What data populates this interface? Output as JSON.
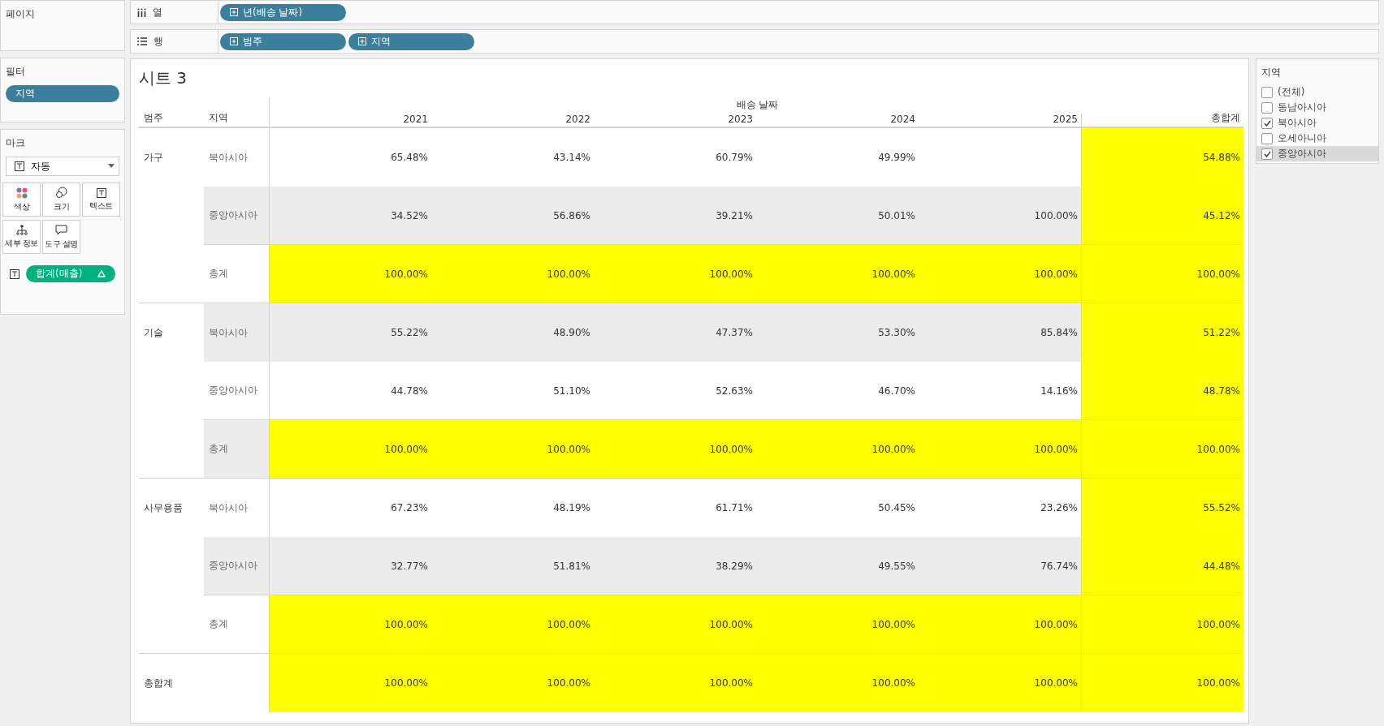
{
  "pages_panel": {
    "title": "페이지"
  },
  "shelves": [
    {
      "kind": "columns",
      "label": "열",
      "pills": [
        "년(배송 날짜)"
      ]
    },
    {
      "kind": "rows",
      "label": "행",
      "pills": [
        "범주",
        "지역"
      ]
    }
  ],
  "filters_panel": {
    "title": "필터",
    "pills": [
      "지역"
    ]
  },
  "marks_panel": {
    "title": "마크",
    "mark_type": "자동",
    "cards": [
      {
        "kind": "color",
        "label": "색상"
      },
      {
        "kind": "size",
        "label": "크기"
      },
      {
        "kind": "text",
        "label": "텍스트"
      },
      {
        "kind": "detail",
        "label": "세부 정보"
      },
      {
        "kind": "tooltip",
        "label": "도구 설명"
      }
    ],
    "fields": [
      {
        "kind": "text",
        "label": "합계(매출)",
        "table_calc": true
      }
    ]
  },
  "sheet": {
    "title": "시트 3",
    "column_header": "배송 날짜",
    "row_headers": [
      "범주",
      "지역"
    ],
    "columns": [
      {
        "label": "2021",
        "highlighted": false
      },
      {
        "label": "2022",
        "highlighted": false
      },
      {
        "label": "2023",
        "highlighted": false
      },
      {
        "label": "2024",
        "highlighted": false
      },
      {
        "label": "2025",
        "highlighted": false
      },
      {
        "label": "총합계",
        "highlighted": true
      }
    ],
    "groups": [
      {
        "category": "가구",
        "rows": [
          {
            "region": "북아시아",
            "banded": false,
            "highlighted": false,
            "cells": [
              {
                "kind": "value",
                "text": "65.48%"
              },
              {
                "kind": "value",
                "text": "43.14%"
              },
              {
                "kind": "value",
                "text": "60.79%"
              },
              {
                "kind": "value",
                "text": "49.99%"
              },
              {
                "kind": "empty"
              },
              {
                "kind": "value",
                "text": "54.88%"
              }
            ]
          },
          {
            "region": "중앙아시아",
            "banded": true,
            "highlighted": false,
            "values": [
              "34.52%",
              "56.86%",
              "39.21%",
              "50.01%",
              "100.00%",
              "45.12%"
            ]
          },
          {
            "region": "총계",
            "banded": false,
            "highlighted": true,
            "values": [
              "100.00%",
              "100.00%",
              "100.00%",
              "100.00%",
              "100.00%",
              "100.00%"
            ]
          }
        ]
      },
      {
        "category": "기술",
        "rows": [
          {
            "region": "북아시아",
            "banded": true,
            "highlighted": false,
            "values": [
              "55.22%",
              "48.90%",
              "47.37%",
              "53.30%",
              "85.84%",
              "51.22%"
            ]
          },
          {
            "region": "중앙아시아",
            "banded": false,
            "highlighted": false,
            "values": [
              "44.78%",
              "51.10%",
              "52.63%",
              "46.70%",
              "14.16%",
              "48.78%"
            ]
          },
          {
            "region": "총계",
            "banded": true,
            "highlighted": true,
            "values": [
              "100.00%",
              "100.00%",
              "100.00%",
              "100.00%",
              "100.00%",
              "100.00%"
            ]
          }
        ]
      },
      {
        "category": "사무용품",
        "rows": [
          {
            "region": "북아시아",
            "banded": false,
            "highlighted": false,
            "values": [
              "67.23%",
              "48.19%",
              "61.71%",
              "50.45%",
              "23.26%",
              "55.52%"
            ]
          },
          {
            "region": "중앙아시아",
            "banded": true,
            "highlighted": false,
            "values": [
              "32.77%",
              "51.81%",
              "38.29%",
              "49.55%",
              "76.74%",
              "44.48%"
            ]
          },
          {
            "region": "총계",
            "banded": false,
            "highlighted": true,
            "values": [
              "100.00%",
              "100.00%",
              "100.00%",
              "100.00%",
              "100.00%",
              "100.00%"
            ]
          }
        ]
      }
    ],
    "grand_total": {
      "label": "총합계",
      "highlighted": true,
      "values": [
        "100.00%",
        "100.00%",
        "100.00%",
        "100.00%",
        "100.00%",
        "100.00%"
      ]
    }
  },
  "legend": {
    "title": "지역",
    "items": [
      {
        "label": "(전체)",
        "checked": false,
        "selected": false
      },
      {
        "label": "동남아시아",
        "checked": false,
        "selected": false
      },
      {
        "label": "북아시아",
        "checked": true,
        "selected": false
      },
      {
        "label": "오세아니아",
        "checked": false,
        "selected": false
      },
      {
        "label": "중앙아시아",
        "checked": true,
        "selected": true
      }
    ]
  }
}
